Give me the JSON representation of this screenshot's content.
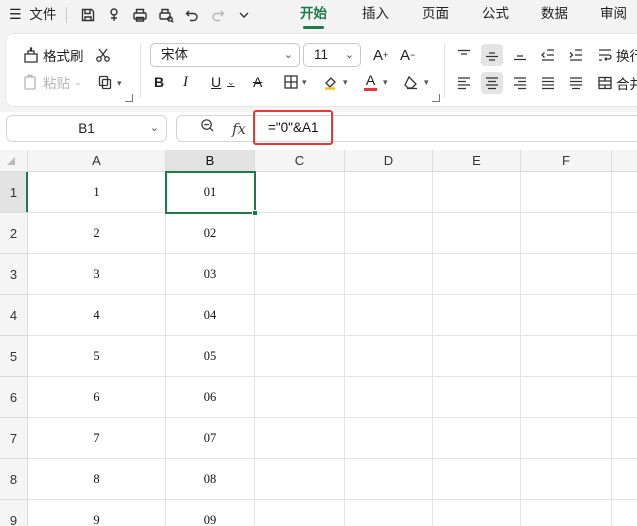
{
  "menubar": {
    "menu_icon": "hamburger-icon",
    "file_label": "文件",
    "tabs": [
      {
        "label": "开始",
        "active": true
      },
      {
        "label": "插入",
        "active": false
      },
      {
        "label": "页面",
        "active": false
      },
      {
        "label": "公式",
        "active": false
      },
      {
        "label": "数据",
        "active": false
      },
      {
        "label": "审阅",
        "active": false
      }
    ],
    "accent_color": "#1e7a4a"
  },
  "ribbon": {
    "format_painter_label": "格式刷",
    "paste_label": "粘贴",
    "font_name": "宋体",
    "font_size": "11",
    "bold_label": "B",
    "italic_label": "I",
    "underline_label": "U",
    "strike_label": "A",
    "grow_font_label": "A",
    "shrink_font_label": "A",
    "font_color_label": "A",
    "wrap_label": "换行",
    "merge_label": "合并"
  },
  "formula_bar": {
    "cell_reference": "B1",
    "fx_label": "fx",
    "formula": "=\"0\"&A1",
    "highlight_color": "#e53935"
  },
  "sheet": {
    "columns": [
      "A",
      "B",
      "C",
      "D",
      "E",
      "F"
    ],
    "selected_column": "B",
    "rows": [
      {
        "row": "1",
        "A": "1",
        "B": "01"
      },
      {
        "row": "2",
        "A": "2",
        "B": "02"
      },
      {
        "row": "3",
        "A": "3",
        "B": "03"
      },
      {
        "row": "4",
        "A": "4",
        "B": "04"
      },
      {
        "row": "5",
        "A": "5",
        "B": "05"
      },
      {
        "row": "6",
        "A": "6",
        "B": "06"
      },
      {
        "row": "7",
        "A": "7",
        "B": "07"
      },
      {
        "row": "8",
        "A": "8",
        "B": "08"
      },
      {
        "row": "9",
        "A": "9",
        "B": "09"
      }
    ],
    "active_cell": "B1"
  }
}
